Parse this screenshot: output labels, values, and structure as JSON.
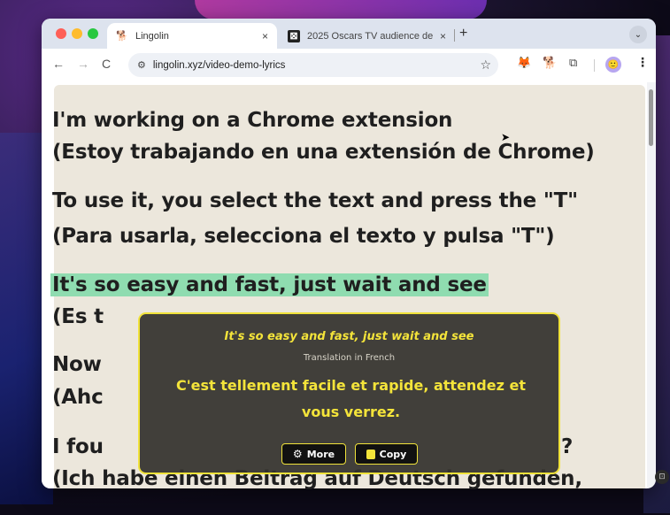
{
  "browser": {
    "tabs": [
      {
        "title": "Lingolin",
        "close": "×",
        "favicon": "dog-icon"
      },
      {
        "title": "2025 Oscars TV audience de",
        "close": "×",
        "favicon": "page-logo-icon",
        "favicon_letter": "⊠"
      }
    ],
    "new_tab": "+",
    "tab_menu": "⌄",
    "url": "lingolin.xyz/video-demo-lyrics",
    "nav": {
      "back": "←",
      "forward": "→",
      "reload": "C"
    },
    "bookmark_icon": "☆",
    "menu_icon": "⋮"
  },
  "lyrics": [
    {
      "text": "I'm working on a Chrome extension"
    },
    {
      "text": "(Estoy trabajando en una extensión de Chrome)"
    },
    {
      "text": "To use it, you select the text and press the \"T\""
    },
    {
      "text": "(Para usarla, selecciona el texto y pulsa \"T\")"
    },
    {
      "text": "It's so easy and fast, just wait and see",
      "highlighted": true
    },
    {
      "text": "(Es t"
    },
    {
      "text": "Now"
    },
    {
      "text": "(Ahc"
    },
    {
      "text": "I fou"
    },
    {
      "text": "(Ich habe einen Beitrag auf Deutsch gefunden,"
    }
  ],
  "lyrics_peek": {
    "right_question": "?"
  },
  "popup": {
    "source_text": "It's so easy and fast, just wait and see",
    "language_label": "Translation in French",
    "translation": "C'est tellement facile et rapide, attendez et vous verrez.",
    "buttons": {
      "more": "More",
      "copy": "Copy"
    }
  },
  "colors": {
    "highlight": "#8fdcb0",
    "popup_accent": "#f4e43a",
    "paper": "#ece7dc"
  }
}
